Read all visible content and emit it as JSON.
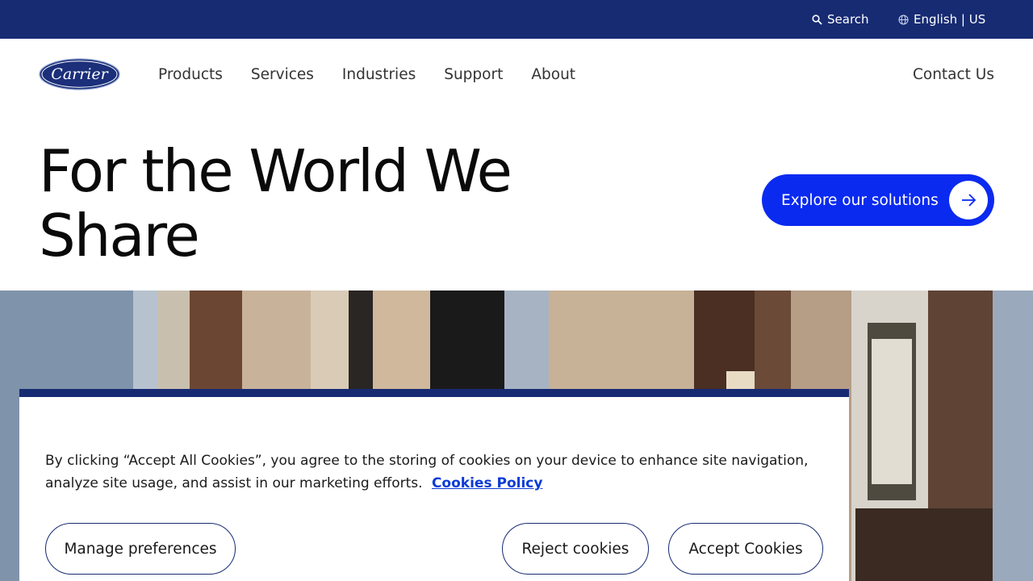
{
  "utility_bar": {
    "search_label": "Search",
    "language_label": "English | US",
    "background_color": "#172b73"
  },
  "brand": {
    "logo_text": "Carrier"
  },
  "nav": {
    "items": [
      {
        "label": "Products"
      },
      {
        "label": "Services"
      },
      {
        "label": "Industries"
      },
      {
        "label": "Support"
      },
      {
        "label": "About"
      }
    ],
    "contact_label": "Contact Us"
  },
  "hero": {
    "title_line1": "For the World We",
    "title_line2": "Share",
    "cta_label": "Explore our solutions",
    "cta_color": "#0b2af0"
  },
  "cookie_banner": {
    "text": "By clicking “Accept All Cookies”, you agree to the storing of cookies on your device to enhance site navigation, analyze site usage, and assist in our marketing efforts.",
    "policy_link": "Cookies Policy",
    "manage_label": "Manage preferences",
    "reject_label": "Reject cookies",
    "accept_label": "Accept Cookies",
    "accent_color": "#172b73"
  },
  "icons": {
    "search": "search-icon",
    "language": "globe-icon",
    "cta_arrow": "arrow-right-icon"
  }
}
